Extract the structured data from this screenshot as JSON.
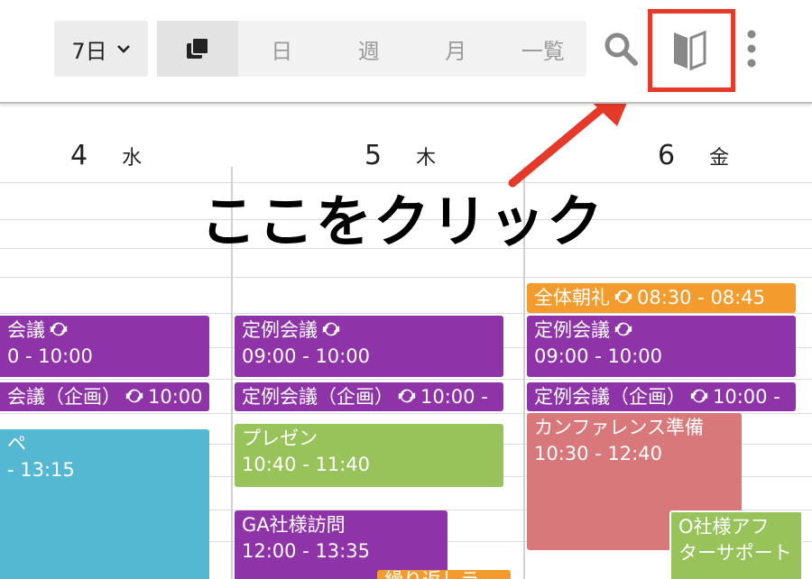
{
  "toolbar": {
    "range_label": "7日",
    "views": [
      "日",
      "週",
      "月",
      "一覧"
    ],
    "search_icon": "search-icon",
    "beginner_icon": "beginner-mark-icon",
    "more_icon": "more-vert-icon"
  },
  "days": [
    {
      "num": "4",
      "dow": "水"
    },
    {
      "num": "5",
      "dow": "木"
    },
    {
      "num": "6",
      "dow": "金"
    }
  ],
  "callout": {
    "text": "ここをクリック",
    "color": "#e53a2a"
  },
  "events": {
    "d4_meeting": {
      "title": "会議",
      "time": "0 - 10:00"
    },
    "d4_planning": {
      "title": "会議（企画）",
      "time": "10:00 -"
    },
    "d4_cyan": {
      "title": "ペ",
      "time": "- 13:15"
    },
    "d5_meeting": {
      "title": "定例会議",
      "time": "09:00 - 10:00"
    },
    "d5_planning": {
      "title": "定例会議（企画）",
      "time": "10:00 -"
    },
    "d5_present": {
      "title": "プレゼン",
      "time": "10:40 - 11:40"
    },
    "d5_ga": {
      "title": "GA社様訪問",
      "time": "12:00 - 13:35"
    },
    "d5_orange_bottom": {
      "title": "繰り返しラ"
    },
    "d6_morning": {
      "title": "全体朝礼",
      "time": "08:30 - 08:45"
    },
    "d6_meeting": {
      "title": "定例会議",
      "time": "09:00 - 10:00"
    },
    "d6_planning": {
      "title": "定例会議（企画）",
      "time": "10:00 -"
    },
    "d6_conf": {
      "title": "カンファレンス準備",
      "time": "10:30 - 12:40"
    },
    "d6_support": {
      "title": "O社様アフ",
      "title2": "ターサポート"
    }
  },
  "colors": {
    "purple": "#8e33a8",
    "orange": "#f39c2d",
    "green": "#98c25a",
    "cyan": "#55b8d3",
    "salmon": "#d9787a"
  }
}
